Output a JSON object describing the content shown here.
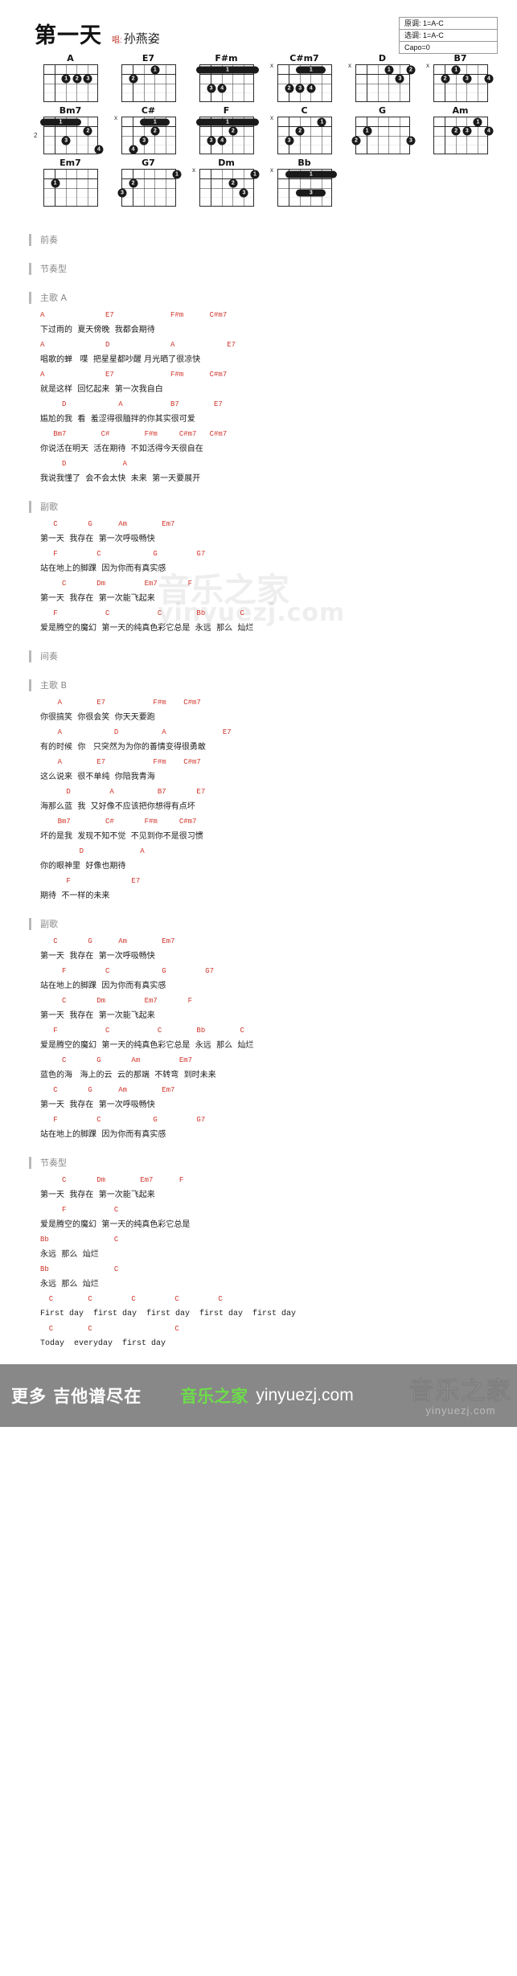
{
  "header": {
    "title": "第一天",
    "sing_tag": "唱:",
    "artist": "孙燕姿",
    "key_original": "原调: 1=A-C",
    "key_selected": "选调: 1=A-C",
    "capo": "Capo=0"
  },
  "chords": [
    [
      {
        "name": "A",
        "muted": "",
        "base": "",
        "dots": [
          {
            "s": 4,
            "f": 2,
            "l": "1"
          },
          {
            "s": 3,
            "f": 2,
            "l": "2"
          },
          {
            "s": 2,
            "f": 2,
            "l": "3"
          }
        ],
        "bars": []
      },
      {
        "name": "E7",
        "muted": "",
        "base": "",
        "dots": [
          {
            "s": 3,
            "f": 1,
            "l": "1"
          },
          {
            "s": 5,
            "f": 2,
            "l": "2"
          }
        ],
        "bars": []
      },
      {
        "name": "F#m",
        "muted": "",
        "base": "",
        "dots": [
          {
            "s": 5,
            "f": 3,
            "l": "3"
          },
          {
            "s": 4,
            "f": 3,
            "l": "4"
          }
        ],
        "bars": [
          {
            "f": 1,
            "from": 6,
            "to": 1,
            "l": "1"
          }
        ]
      },
      {
        "name": "C#m7",
        "muted": "x",
        "base": "",
        "dots": [
          {
            "s": 5,
            "f": 3,
            "l": "2"
          },
          {
            "s": 4,
            "f": 3,
            "l": "3"
          },
          {
            "s": 3,
            "f": 3,
            "l": "4"
          }
        ],
        "bars": [
          {
            "f": 1,
            "from": 4,
            "to": 2,
            "l": "1"
          }
        ]
      },
      {
        "name": "D",
        "muted": "x",
        "base": "",
        "dots": [
          {
            "s": 3,
            "f": 1,
            "l": "1"
          },
          {
            "s": 1,
            "f": 1,
            "l": "2"
          },
          {
            "s": 2,
            "f": 2,
            "l": "3"
          }
        ],
        "bars": []
      },
      {
        "name": "B7",
        "muted": "x",
        "base": "",
        "dots": [
          {
            "s": 4,
            "f": 1,
            "l": "1"
          },
          {
            "s": 5,
            "f": 2,
            "l": "2"
          },
          {
            "s": 3,
            "f": 2,
            "l": "3"
          },
          {
            "s": 1,
            "f": 2,
            "l": "4"
          }
        ],
        "bars": []
      }
    ],
    [
      {
        "name": "Bm7",
        "muted": "",
        "base": "2",
        "dots": [
          {
            "s": 2,
            "f": 2,
            "l": "2"
          },
          {
            "s": 4,
            "f": 3,
            "l": "3"
          },
          {
            "s": 1,
            "f": 4,
            "l": "4"
          }
        ],
        "bars": [
          {
            "f": 1,
            "from": 6,
            "to": 3,
            "l": "1"
          }
        ]
      },
      {
        "name": "C#",
        "muted": "x",
        "base": "",
        "dots": [
          {
            "s": 3,
            "f": 2,
            "l": "2"
          },
          {
            "s": 4,
            "f": 3,
            "l": "3"
          },
          {
            "s": 5,
            "f": 4,
            "l": "4"
          }
        ],
        "bars": [
          {
            "f": 1,
            "from": 4,
            "to": 2,
            "l": "1"
          }
        ]
      },
      {
        "name": "F",
        "muted": "",
        "base": "",
        "dots": [
          {
            "s": 3,
            "f": 2,
            "l": "2"
          },
          {
            "s": 5,
            "f": 3,
            "l": "3"
          },
          {
            "s": 4,
            "f": 3,
            "l": "4"
          }
        ],
        "bars": [
          {
            "f": 1,
            "from": 6,
            "to": 1,
            "l": "1"
          }
        ]
      },
      {
        "name": "C",
        "muted": "x",
        "base": "",
        "dots": [
          {
            "s": 2,
            "f": 1,
            "l": "1"
          },
          {
            "s": 4,
            "f": 2,
            "l": "2"
          },
          {
            "s": 5,
            "f": 3,
            "l": "3"
          }
        ],
        "bars": []
      },
      {
        "name": "G",
        "muted": "",
        "base": "",
        "dots": [
          {
            "s": 5,
            "f": 2,
            "l": "1"
          },
          {
            "s": 6,
            "f": 3,
            "l": "2"
          },
          {
            "s": 1,
            "f": 3,
            "l": "3"
          }
        ],
        "bars": []
      },
      {
        "name": "Am",
        "muted": "",
        "base": "",
        "dots": [
          {
            "s": 2,
            "f": 1,
            "l": "1"
          },
          {
            "s": 4,
            "f": 2,
            "l": "2"
          },
          {
            "s": 3,
            "f": 2,
            "l": "3"
          },
          {
            "s": 1,
            "f": 2,
            "l": "4"
          }
        ],
        "bars": []
      }
    ],
    [
      {
        "name": "Em7",
        "muted": "",
        "base": "",
        "dots": [
          {
            "s": 5,
            "f": 2,
            "l": "1"
          }
        ],
        "bars": []
      },
      {
        "name": "G7",
        "muted": "",
        "base": "",
        "dots": [
          {
            "s": 1,
            "f": 1,
            "l": "1"
          },
          {
            "s": 5,
            "f": 2,
            "l": "2"
          },
          {
            "s": 6,
            "f": 3,
            "l": "3"
          }
        ],
        "bars": []
      },
      {
        "name": "Dm",
        "muted": "x",
        "base": "",
        "dots": [
          {
            "s": 1,
            "f": 1,
            "l": "1"
          },
          {
            "s": 3,
            "f": 2,
            "l": "2"
          },
          {
            "s": 2,
            "f": 3,
            "l": "3"
          }
        ],
        "bars": []
      },
      {
        "name": "Bb",
        "muted": "x",
        "base": "",
        "dots": [],
        "bars": [
          {
            "f": 1,
            "from": 5,
            "to": 1,
            "l": "1"
          },
          {
            "f": 3,
            "from": 4,
            "to": 2,
            "l": "3"
          }
        ]
      }
    ]
  ],
  "sections": [
    {
      "label": "前奏",
      "lines": []
    },
    {
      "label": "节奏型",
      "lines": []
    },
    {
      "label": "主歌 A",
      "lines": [
        {
          "chords": "A              E7             F#m      C#m7",
          "lyrics": "下过雨的  夏天傍晚  我都会期待"
        },
        {
          "chords": "A              D              A            E7",
          "lyrics": "唱歌的蝉   喋  把星星都吵醒 月光晒了很凉快"
        },
        {
          "chords": "A              E7             F#m      C#m7",
          "lyrics": "就是这样  回忆起来  第一次我自白"
        },
        {
          "chords": "     D            A           B7        E7",
          "lyrics": "尴尬的我  看  羞涩得很腼拌的你其实很可爱"
        },
        {
          "chords": "   Bm7        C#        F#m     C#m7   C#m7",
          "lyrics": "你说活在明天  活在期待  不如活得今天很自在"
        },
        {
          "chords": "     D             A",
          "lyrics": "我说我懂了  会不会太快  未来  第一天要展开"
        }
      ]
    },
    {
      "label": "副歌",
      "lines": [
        {
          "chords": "   C       G      Am        Em7",
          "lyrics": "第一天  我存在  第一次呼吸畅快"
        },
        {
          "chords": "   F         C            G         G7",
          "lyrics": "站在地上的脚踝  因为你而有真实感"
        },
        {
          "chords": "     C       Dm         Em7       F",
          "lyrics": "第一天  我存在  第一次能飞起来"
        },
        {
          "chords": "   F           C           C        Bb        C",
          "lyrics": "爱是腾空的魔幻  第一天的纯真色彩它总是  永远  那么  灿烂"
        }
      ]
    },
    {
      "label": "间奏",
      "lines": []
    },
    {
      "label": "主歌 B",
      "lines": [
        {
          "chords": "    A        E7           F#m    C#m7",
          "lyrics": "你很搞笑  你很会笑  你天天要跑"
        },
        {
          "chords": "    A            D          A             E7",
          "lyrics": "有的时候  你   只突然为为你的善情变得很勇敢"
        },
        {
          "chords": "    A        E7           F#m    C#m7",
          "lyrics": "这么说来  很不单纯  你陪我青海"
        },
        {
          "chords": "      D         A          B7       E7",
          "lyrics": "海那么蓝  我  又好像不应该把你想得有点坏"
        },
        {
          "chords": "    Bm7        C#       F#m     C#m7",
          "lyrics": "坏的是我  发现不知不觉  不见到你不是很习惯"
        },
        {
          "chords": "         D             A",
          "lyrics": "你的眼神里  好像也期待"
        },
        {
          "chords": "      F              E7",
          "lyrics": "期待  不一样的未来"
        }
      ]
    },
    {
      "label": "副歌",
      "lines": [
        {
          "chords": "   C       G      Am        Em7",
          "lyrics": "第一天  我存在  第一次呼吸畅快"
        },
        {
          "chords": "     F         C            G         G7",
          "lyrics": "站在地上的脚踝  因为你而有真实感"
        },
        {
          "chords": "     C       Dm         Em7       F",
          "lyrics": "第一天  我存在  第一次能飞起来"
        },
        {
          "chords": "   F           C           C        Bb        C",
          "lyrics": "爱是腾空的魔幻  第一天的纯真色彩它总是  永远  那么  灿烂"
        },
        {
          "chords": "     C       G       Am         Em7",
          "lyrics": "蓝色的海   海上的云  云的那端  不转弯  到时未来"
        },
        {
          "chords": "   C       G      Am        Em7",
          "lyrics": "第一天  我存在  第一次呼吸畅快"
        },
        {
          "chords": "   F         C            G         G7",
          "lyrics": "站在地上的脚踝  因为你而有真实感"
        }
      ]
    },
    {
      "label": "节奏型",
      "lines": [
        {
          "chords": "     C       Dm        Em7      F",
          "lyrics": "第一天  我存在  第一次能飞起来"
        },
        {
          "chords": "     F           C",
          "lyrics": "爱是腾空的魔幻  第一天的纯真色彩它总是"
        },
        {
          "chords": "Bb               C",
          "lyrics": "永远  那么  灿烂"
        },
        {
          "chords": "Bb               C",
          "lyrics": "永远  那么  灿烂"
        },
        {
          "chords": "  C        C         C         C         C",
          "lyrics": "First day  first day  first day  first day  first day",
          "en": true
        },
        {
          "chords": "  C        C                   C",
          "lyrics": "Today  everyday  first day",
          "en": true
        }
      ]
    }
  ],
  "watermark": {
    "main": "音乐之家",
    "url": "yinyuezj.com"
  },
  "footer": {
    "left": "更多 吉他谱尽在",
    "brand": "音乐之家",
    "url": "yinyuezj.com",
    "wm_main": "音乐之家",
    "wm_sub": "yinyuezj.com"
  }
}
